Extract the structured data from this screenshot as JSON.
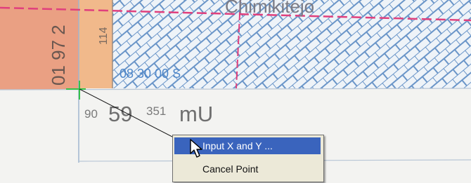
{
  "map": {
    "street_name": "Chimikitejo",
    "parcel_side_number": "01 97 2",
    "parcel_number_small": "114",
    "coordinate_label": "08 30 00 S",
    "zone_prefix": "90",
    "zone_code": "59",
    "zone_sub": "351",
    "zone_unit": "mU",
    "colors": {
      "background": "#f3f3f1",
      "parcel_salmon": "#eaa083",
      "parcel_orange": "#f1b98b",
      "hatch_blue": "#6a95c8",
      "boundary_pink": "#e0407d",
      "label_blue": "#4d86c9",
      "cursor_green": "#35c24a"
    }
  },
  "context_menu": {
    "items": [
      {
        "label": "Input X and Y ...",
        "highlighted": true
      },
      {
        "label": "Cancel Point",
        "highlighted": false
      }
    ],
    "highlight_color": "#3a64bd",
    "background_color": "#ece9d8"
  },
  "cursor": {
    "icon": "arrow-pointer-icon"
  }
}
